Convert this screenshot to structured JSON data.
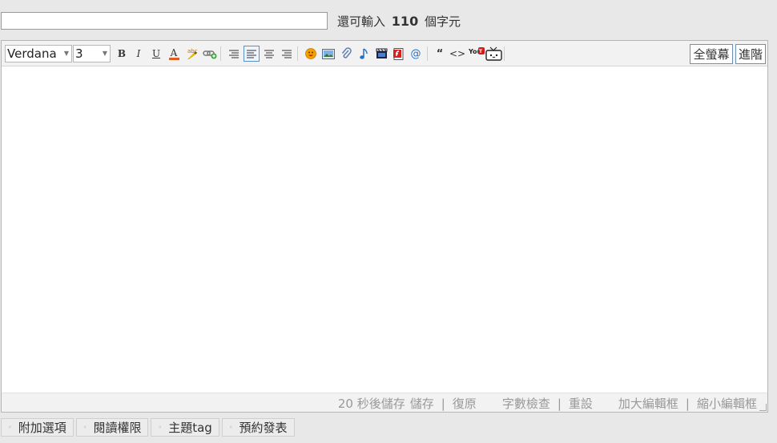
{
  "title_field": {
    "value": "",
    "placeholder": ""
  },
  "counter": {
    "prefix": "還可輸入",
    "count": "110",
    "suffix": "個字元"
  },
  "toolbar": {
    "font": "Verdana",
    "size": "3",
    "bold": "B",
    "italic": "I",
    "underline": "U",
    "forecolor": "A",
    "spellcheck": "abc",
    "quote": "“",
    "code": "<>",
    "youtube": "You",
    "fullscreen_label": "全螢幕",
    "advanced_label": "進階",
    "icons": [
      "bold-icon",
      "italic-icon",
      "underline-icon",
      "font-color-icon",
      "highlight-icon",
      "insert-link-icon",
      "align-left-icon",
      "align-justify-icon",
      "align-center-icon",
      "align-right-icon",
      "smiley-icon",
      "image-icon",
      "attachment-icon",
      "music-icon",
      "video-icon",
      "flash-icon",
      "email-icon",
      "quote-icon",
      "code-icon",
      "youtube-icon",
      "tv-icon"
    ],
    "colors": {
      "accent": "#5a8fc7",
      "font_color_bar": "#e25a1c",
      "smiley": "#f2a100",
      "flash": "#d42222"
    }
  },
  "editor": {
    "content": ""
  },
  "status": {
    "autosave": "20 秒後儲存",
    "save": "儲存",
    "restore": "復原",
    "wordcount": "字數檢查",
    "reset": "重設",
    "enlarge": "加大編輯框",
    "shrink": "縮小編輯框"
  },
  "bottom_tabs": [
    "附加選項",
    "閱讀權限",
    "主題tag",
    "預約發表"
  ]
}
